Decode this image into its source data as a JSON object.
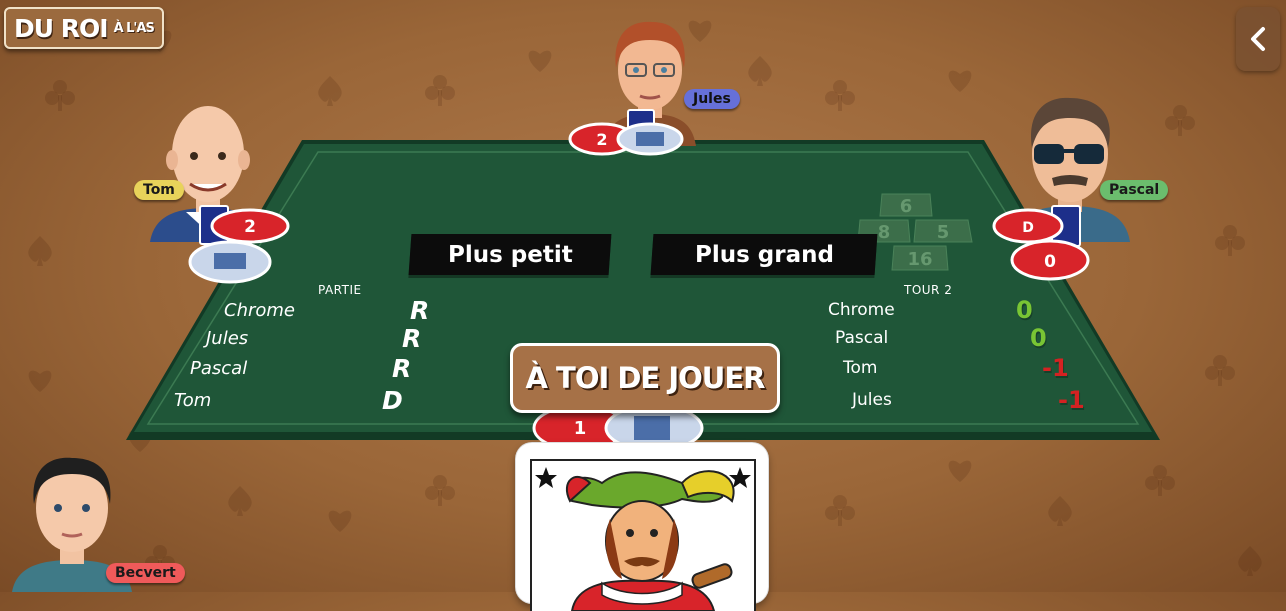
{
  "app": {
    "logo_big": "DU ROI",
    "logo_small": "À L'AS"
  },
  "colors": {
    "felt": "#1f5638",
    "felt_dark": "#163f29",
    "chip_red": "#d8242a",
    "chip_blue": "#c9d6ea",
    "score_positive": "#79c534",
    "score_negative": "#d42222",
    "turn_button": "#a67147"
  },
  "players": {
    "top": {
      "name": "Jules",
      "badge_color": "#6670d9",
      "bet_chip": "2"
    },
    "left": {
      "name": "Tom",
      "badge_color": "#e8d35a",
      "bet_chip": "2"
    },
    "right": {
      "name": "Pascal",
      "badge_color": "#6bbd6d",
      "bet_chip": "0",
      "dealer_chip": "D"
    },
    "self": {
      "name": "Becvert",
      "badge_color": "#ef5a5a",
      "bet_chip": "1"
    }
  },
  "actions": {
    "lower": "Plus petit",
    "higher": "Plus grand",
    "turn_prompt": "À TOI DE JOUER"
  },
  "board_numbers": [
    "6",
    "8",
    "5",
    "16"
  ],
  "partie": {
    "label": "PARTIE",
    "rows": [
      {
        "name": "Chrome",
        "result": "R"
      },
      {
        "name": "Jules",
        "result": "R"
      },
      {
        "name": "Pascal",
        "result": "R"
      },
      {
        "name": "Tom",
        "result": "D"
      }
    ]
  },
  "tour": {
    "label": "TOUR 2",
    "rows": [
      {
        "name": "Chrome",
        "score": "0",
        "kind": "positive"
      },
      {
        "name": "Pascal",
        "score": "0",
        "kind": "positive"
      },
      {
        "name": "Tom",
        "score": "-1",
        "kind": "negative"
      },
      {
        "name": "Jules",
        "score": "-1",
        "kind": "negative"
      }
    ]
  },
  "hand_card": {
    "face": "jack",
    "corner_icon": "star-icon"
  }
}
